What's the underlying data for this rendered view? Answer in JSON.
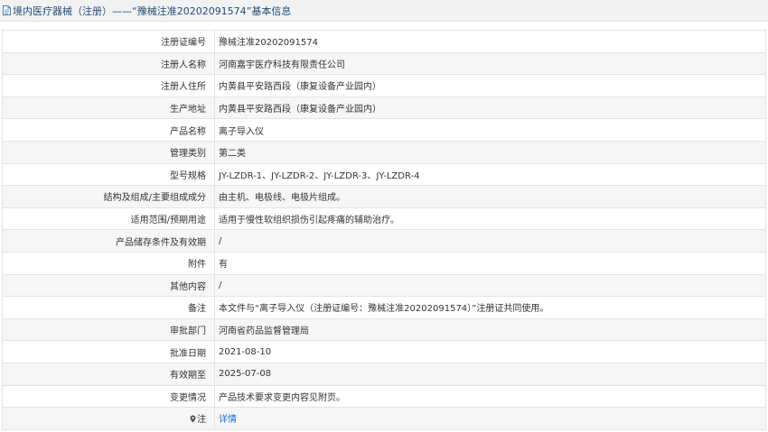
{
  "header": {
    "title": "境内医疗器械（注册）——“豫械注准20202091574”基本信息"
  },
  "rows": [
    {
      "label": "注册证编号",
      "value": "豫械注准20202091574"
    },
    {
      "label": "注册人名称",
      "value": "河南嘉宇医疗科技有限责任公司"
    },
    {
      "label": "注册人住所",
      "value": "内黄县平安路西段（康复设备产业园内）"
    },
    {
      "label": "生产地址",
      "value": "内黄县平安路西段（康复设备产业园内）"
    },
    {
      "label": "产品名称",
      "value": "离子导入仪"
    },
    {
      "label": "管理类别",
      "value": "第二类"
    },
    {
      "label": "型号规格",
      "value": "JY-LZDR-1、JY-LZDR-2、JY-LZDR-3、JY-LZDR-4"
    },
    {
      "label": "结构及组成/主要组成成分",
      "value": "由主机、电极线、电极片组成。"
    },
    {
      "label": "适用范围/预期用途",
      "value": "适用于慢性软组织损伤引起疼痛的辅助治疗。"
    },
    {
      "label": "产品储存条件及有效期",
      "value": "/"
    },
    {
      "label": "附件",
      "value": "有"
    },
    {
      "label": "其他内容",
      "value": "/"
    },
    {
      "label": "备注",
      "value": "本文件与“离子导入仪（注册证编号：豫械注准20202091574）”注册证共同使用。"
    },
    {
      "label": "审批部门",
      "value": "河南省药品监督管理局"
    },
    {
      "label": "批准日期",
      "value": "2021-08-10"
    },
    {
      "label": "有效期至",
      "value": "2025-07-08"
    },
    {
      "label": "变更情况",
      "value": "产品技术要求变更内容见附页。"
    }
  ],
  "note_row": {
    "label": "注",
    "link_text": "详情",
    "icon": "pin-icon"
  },
  "colors": {
    "header_bg": "#f2f2f2",
    "title": "#1f4e79",
    "link": "#1a6fc4",
    "border": "#e4e4e4"
  }
}
